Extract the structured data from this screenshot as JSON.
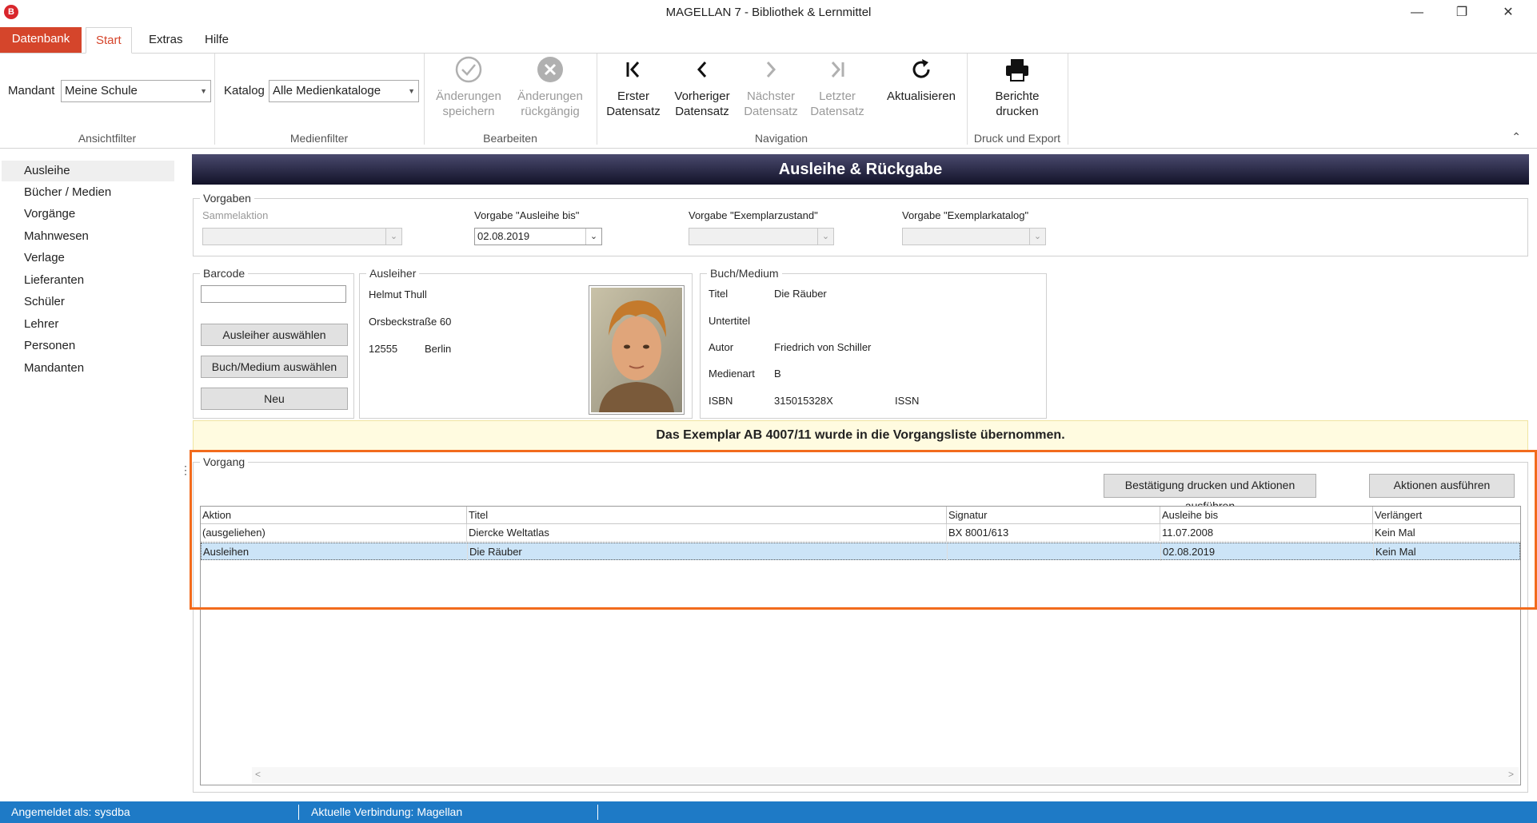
{
  "window": {
    "title": "MAGELLAN 7 - Bibliothek & Lernmittel",
    "icon_letter": "B",
    "minimize": "—",
    "maximize": "❐",
    "close": "✕"
  },
  "ribbon_tabs": {
    "datenbank": "Datenbank",
    "start": "Start",
    "extras": "Extras",
    "hilfe": "Hilfe"
  },
  "ribbon": {
    "mandant_label": "Mandant",
    "mandant_value": "Meine Schule",
    "katalog_label": "Katalog",
    "katalog_value": "Alle Medienkataloge",
    "groups": {
      "ansichtfilter": "Ansichtfilter",
      "medienfilter": "Medienfilter",
      "bearbeiten": "Bearbeiten",
      "navigation": "Navigation",
      "druck": "Druck und Export"
    },
    "buttons": {
      "save": [
        "Änderungen",
        "speichern"
      ],
      "undo": [
        "Änderungen",
        "rückgängig"
      ],
      "first": [
        "Erster",
        "Datensatz"
      ],
      "prev": [
        "Vorheriger",
        "Datensatz"
      ],
      "next": [
        "Nächster",
        "Datensatz"
      ],
      "last": [
        "Letzter",
        "Datensatz"
      ],
      "refresh": [
        "Aktualisieren",
        ""
      ],
      "reports": [
        "Berichte",
        "drucken"
      ]
    }
  },
  "nav": {
    "items": [
      "Ausleihe",
      "Bücher / Medien",
      "Vorgänge",
      "Mahnwesen",
      "Verlage",
      "Lieferanten",
      "Schüler",
      "Lehrer",
      "Personen",
      "Mandanten"
    ]
  },
  "main": {
    "header": "Ausleihe & Rückgabe",
    "vorgaben": {
      "title": "Vorgaben",
      "sammelaktion_label": "Sammelaktion",
      "ausleihe_bis_label": "Vorgabe \"Ausleihe bis\"",
      "ausleihe_bis_value": "02.08.2019",
      "zustand_label": "Vorgabe \"Exemplarzustand\"",
      "katalog_label": "Vorgabe \"Exemplarkatalog\""
    },
    "barcode": {
      "title": "Barcode",
      "value": "",
      "btn_ausleiher": "Ausleiher auswählen",
      "btn_medium": "Buch/Medium auswählen",
      "btn_neu": "Neu"
    },
    "ausleiher": {
      "title": "Ausleiher",
      "name": "Helmut Thull",
      "street": "Orsbeckstraße 60",
      "zip": "12555",
      "city": "Berlin"
    },
    "medium": {
      "title": "Buch/Medium",
      "titel_label": "Titel",
      "titel_value": "Die Räuber",
      "untertitel_label": "Untertitel",
      "untertitel_value": "",
      "autor_label": "Autor",
      "autor_value": "Friedrich von Schiller",
      "medienart_label": "Medienart",
      "medienart_value": "B",
      "isbn_label": "ISBN",
      "isbn_value": "315015328X",
      "issn_label": "ISSN",
      "issn_value": ""
    },
    "info_message": "Das Exemplar AB 4007/11 wurde in die Vorgangsliste übernommen.",
    "vorgang": {
      "title": "Vorgang",
      "btn_print_exec": "Bestätigung drucken und Aktionen ausführen",
      "btn_exec": "Aktionen ausführen",
      "columns": [
        "Aktion",
        "Titel",
        "Signatur",
        "Ausleihe bis",
        "Verlängert"
      ],
      "rows": [
        [
          "(ausgeliehen)",
          "Diercke Weltatlas",
          "BX 8001/613",
          "11.07.2008",
          "Kein Mal"
        ],
        [
          "Ausleihen",
          "Die Räuber",
          "",
          "02.08.2019",
          "Kein Mal"
        ]
      ]
    }
  },
  "status": {
    "user": "Angemeldet als: sysdba",
    "connection": "Aktuelle Verbindung: Magellan"
  },
  "colors": {
    "accent": "#d5452b",
    "status_bar": "#1e7ac6",
    "highlight": "#f26b1d",
    "selection": "#cce4f7"
  }
}
